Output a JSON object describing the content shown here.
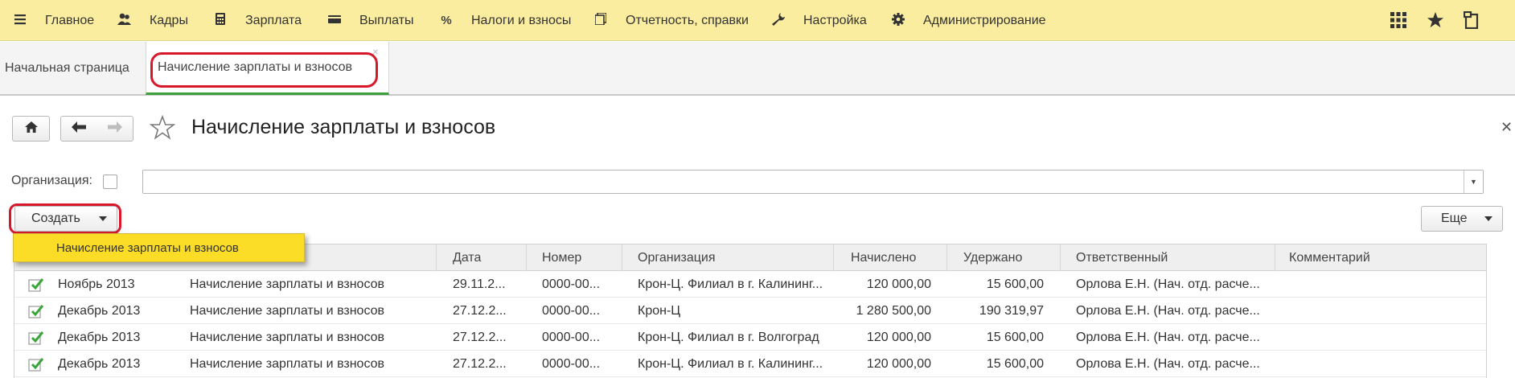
{
  "menu": {
    "items": [
      {
        "icon": "hamburger-icon",
        "label": "Главное"
      },
      {
        "icon": "people-icon",
        "label": "Кадры"
      },
      {
        "icon": "calculator-icon",
        "label": "Зарплата"
      },
      {
        "icon": "wallet-icon",
        "label": "Выплаты"
      },
      {
        "icon": "percent-icon",
        "label": "Налоги и взносы"
      },
      {
        "icon": "reports-icon",
        "label": "Отчетность, справки"
      },
      {
        "icon": "wrench-icon",
        "label": "Настройка"
      },
      {
        "icon": "gear-icon",
        "label": "Администрирование"
      }
    ],
    "right_icons": [
      "apps-grid-icon",
      "star-icon",
      "history-icon"
    ]
  },
  "tabs": {
    "home": "Начальная страница",
    "active": "Начисление зарплаты и взносов"
  },
  "form": {
    "title": "Начисление зарплаты и взносов",
    "org_label": "Организация:",
    "org_value": "",
    "create_label": "Создать",
    "more_label": "Еще",
    "dropdown_item": "Начисление зарплаты и взносов"
  },
  "table": {
    "columns": [
      "Дата",
      "Номер",
      "Организация",
      "Начислено",
      "Удержано",
      "Ответственный",
      "Комментарий"
    ],
    "rows": [
      {
        "period": "Ноябрь 2013",
        "type": "Начисление зарплаты и взносов",
        "date": "29.11.2...",
        "number": "0000-00...",
        "org": "Крон-Ц. Филиал в г. Калининг...",
        "accrued": "120 000,00",
        "withheld": "15 600,00",
        "responsible": "Орлова Е.Н. (Нач. отд. расче...",
        "comment": ""
      },
      {
        "period": "Декабрь 2013",
        "type": "Начисление зарплаты и взносов",
        "date": "27.12.2...",
        "number": "0000-00...",
        "org": "Крон-Ц",
        "accrued": "1 280 500,00",
        "withheld": "190 319,97",
        "responsible": "Орлова Е.Н. (Нач. отд. расче...",
        "comment": ""
      },
      {
        "period": "Декабрь 2013",
        "type": "Начисление зарплаты и взносов",
        "date": "27.12.2...",
        "number": "0000-00...",
        "org": "Крон-Ц. Филиал в г. Волгоград",
        "accrued": "120 000,00",
        "withheld": "15 600,00",
        "responsible": "Орлова Е.Н. (Нач. отд. расче...",
        "comment": ""
      },
      {
        "period": "Декабрь 2013",
        "type": "Начисление зарплаты и взносов",
        "date": "27.12.2...",
        "number": "0000-00...",
        "org": "Крон-Ц. Филиал в г. Калининг...",
        "accrued": "120 000,00",
        "withheld": "15 600,00",
        "responsible": "Орлова Е.Н. (Нач. отд. расче...",
        "comment": ""
      }
    ]
  },
  "colors": {
    "menu_bg": "#fbeda0",
    "highlight": "#fbdc26",
    "annotation_red": "#d8182a",
    "active_tab_underline": "#3c9e3c"
  }
}
